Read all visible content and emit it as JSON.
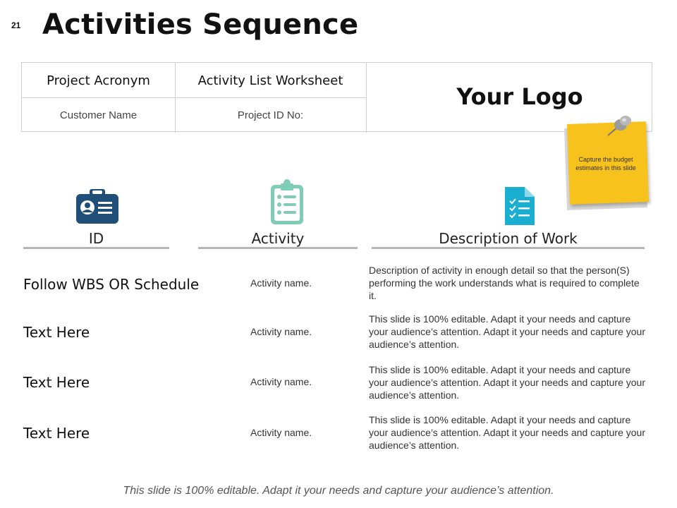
{
  "slide_number": "21",
  "title": "Activities Sequence",
  "header_table": {
    "project_acronym": "Project Acronym",
    "activity_list_worksheet": "Activity List Worksheet",
    "customer_name": "Customer Name",
    "project_id": "Project ID No:",
    "logo": "Your Logo"
  },
  "sticky_note": "Capture the budget estimates in this slide",
  "columns": {
    "id": "ID",
    "activity": "Activity",
    "description": "Description of Work"
  },
  "rows": [
    {
      "id": "Follow WBS OR Schedule",
      "activity": "Activity name.",
      "description": "Description of activity in enough detail so that the person(S) performing the work understands what is required to complete it."
    },
    {
      "id": "Text Here",
      "activity": "Activity name.",
      "description": "This slide is 100% editable. Adapt it your needs and capture your audience’s attention. Adapt it your needs and capture your audience’s attention."
    },
    {
      "id": "Text Here",
      "activity": "Activity name.",
      "description": "This slide is 100% editable. Adapt it your needs and capture your audience’s attention. Adapt it your needs and capture your audience’s attention."
    },
    {
      "id": "Text Here",
      "activity": "Activity name.",
      "description": "This slide is 100% editable. Adapt it your needs and capture your audience’s attention. Adapt it your needs and capture your audience’s attention."
    }
  ],
  "footer": "This slide is 100% editable. Adapt it your needs and capture your audience’s attention.",
  "colors": {
    "id_icon": "#1f4e79",
    "activity_icon": "#7fcdb7",
    "description_icon": "#1aaed0",
    "sticky": "#f7c21b",
    "rule": "#b5b5b5"
  },
  "icons": {
    "id": "id-badge-icon",
    "activity": "clipboard-list-icon",
    "description": "document-checklist-icon",
    "sticky_pin": "pushpin-icon"
  }
}
